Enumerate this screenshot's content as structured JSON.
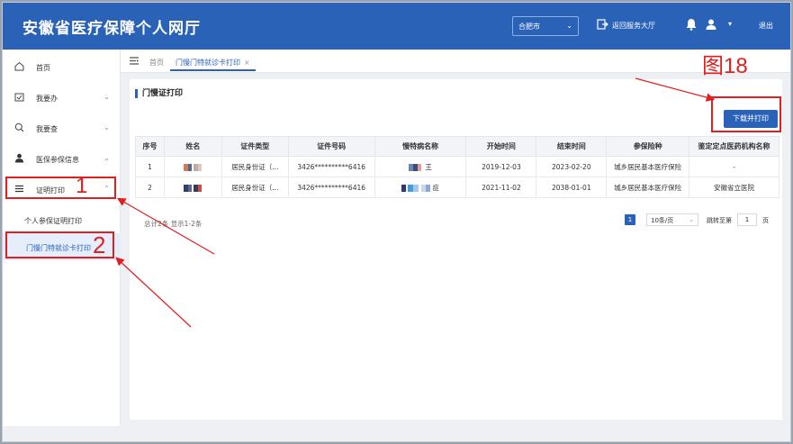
{
  "header": {
    "title": "安徽省医疗保障个人网厅",
    "city": "合肥市",
    "back_link": "返回服务大厅",
    "logout": "退出"
  },
  "sidebar": {
    "items": [
      {
        "label": "首页",
        "icon": "home-icon"
      },
      {
        "label": "我要办",
        "icon": "briefcase-icon"
      },
      {
        "label": "我要查",
        "icon": "search-icon"
      },
      {
        "label": "医保参保信息",
        "icon": "user-icon"
      },
      {
        "label": "证明打印",
        "icon": "list-icon"
      }
    ],
    "sub_items": [
      {
        "label": "个人参保证明打印"
      },
      {
        "label": "门慢门特就诊卡打印"
      }
    ]
  },
  "tabs": {
    "home": "首页",
    "active": "门慢门特就诊卡打印",
    "close": "×"
  },
  "panel": {
    "title": "门慢证打印",
    "download_button": "下载并打印"
  },
  "table": {
    "headers": [
      "序号",
      "姓名",
      "证件类型",
      "证件号码",
      "慢特病名称",
      "开始时间",
      "结束时间",
      "参保险种",
      "鉴定定点医药机构名称"
    ],
    "rows": [
      {
        "no": "1",
        "id_type": "居民身份证（...",
        "id_number": "3426**********6416",
        "disease_suffix": "王",
        "start": "2019-12-03",
        "end": "2023-02-20",
        "insurance": "城乡居民基本医疗保险",
        "institution": "-"
      },
      {
        "no": "2",
        "id_type": "居民身份证（...",
        "id_number": "3426**********6416",
        "disease_suffix": "症",
        "start": "2021-11-02",
        "end": "2038-01-01",
        "insurance": "城乡居民基本医疗保险",
        "institution": "安徽省立医院"
      }
    ]
  },
  "pager": {
    "info": "总计2条 显示1-2条",
    "current_page": "1",
    "page_size": "10条/页",
    "goto_label": "跳转至第",
    "goto_value": "1",
    "page_unit": "页"
  },
  "annotations": {
    "figure_label": "图18",
    "step1": "1",
    "step2": "2"
  },
  "colors": {
    "brand": "#2a62b8",
    "annotation": "#e02020"
  }
}
